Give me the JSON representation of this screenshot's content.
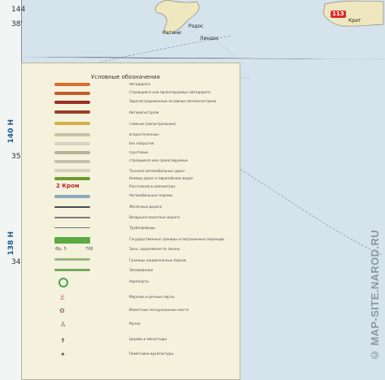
{
  "left_frame": {
    "top_numbers": [
      "144"
    ],
    "coords": [
      "38'",
      "35'",
      "34'"
    ],
    "vertical_labels": [
      "140 H",
      "138 H"
    ]
  },
  "map": {
    "labels": {
      "katania": "Катани",
      "rodos": "Родос",
      "linidos": "Линдос",
      "krit": "Крит",
      "route_number": "113"
    }
  },
  "legend": {
    "title": "Условные обозначения",
    "items": [
      {
        "text": "Автодороги"
      },
      {
        "text": "Строящиеся или проектируемые автодороги"
      },
      {
        "text": "Зарегистрированные основные автомагистрали"
      },
      {
        "text": "Автомагистрали"
      },
      {
        "text": "главные (магистральные)"
      },
      {
        "text": "второстепенные"
      },
      {
        "text": "без покрытия"
      },
      {
        "text": "грунтовые"
      },
      {
        "text": "строящиеся или проектируемые"
      },
      {
        "text": "Тоннели автомобильных дорог"
      },
      {
        "text": "Номера дорог в европейских водах"
      },
      {
        "text": "Расстояния в километрах"
      },
      {
        "text": "Автомобильные паромы"
      },
      {
        "text": "Железные дороги"
      },
      {
        "text": "Воздушно-канатные дороги"
      },
      {
        "text": "Трубопроводы"
      },
      {
        "text": "Государственные границы и пограничные переходы"
      },
      {
        "text": "Зона, охраняемая по закону"
      },
      {
        "text": "Границы национальных парков"
      },
      {
        "text": "Заповедники"
      },
      {
        "text": "Аэропорты"
      },
      {
        "text": "Морские и речные порты"
      },
      {
        "text": "Известные экскурсионные места"
      },
      {
        "text": "Музеи"
      },
      {
        "text": "Церкви и монастыри"
      },
      {
        "text": "Памятники архитектуры"
      }
    ],
    "symbols": {
      "elevation1": "2 Кром",
      "elevation2": "Фр. 5",
      "elevation3": "798"
    }
  },
  "watermark": "© MAP-SITE.NAROD.RU"
}
